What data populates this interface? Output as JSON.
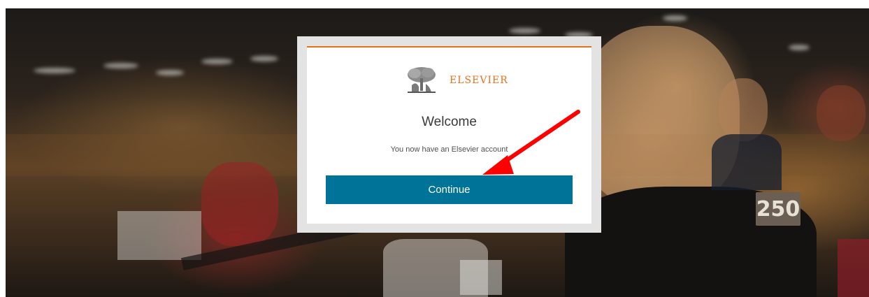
{
  "brand": {
    "name": "ELSEVIER",
    "logo_icon": "elsevier-tree-icon",
    "accent_color": "#e9711c"
  },
  "dialog": {
    "title": "Welcome",
    "message": "You now have an Elsevier account",
    "continue_label": "Continue",
    "button_color": "#007398"
  },
  "background": {
    "seat_sign": "250"
  },
  "annotation": {
    "arrow_color": "#ff0000",
    "arrow_icon": "red-arrow-icon"
  }
}
